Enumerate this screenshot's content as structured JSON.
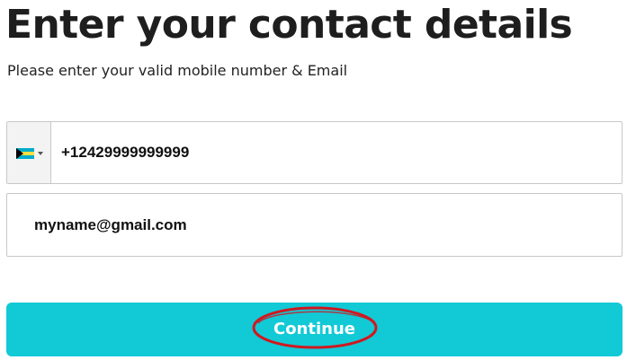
{
  "header": {
    "title": "Enter your contact details",
    "subtitle": "Please enter your valid mobile number & Email"
  },
  "phone": {
    "country_flag": "bahamas-flag",
    "value": "+12429999999999"
  },
  "email": {
    "value": "myname@gmail.com"
  },
  "actions": {
    "continue_label": "Continue"
  },
  "colors": {
    "button_bg": "#12c9d6",
    "button_text": "#ffffff",
    "annotation_ring": "#d0181f",
    "field_border": "#c8c8c8"
  }
}
